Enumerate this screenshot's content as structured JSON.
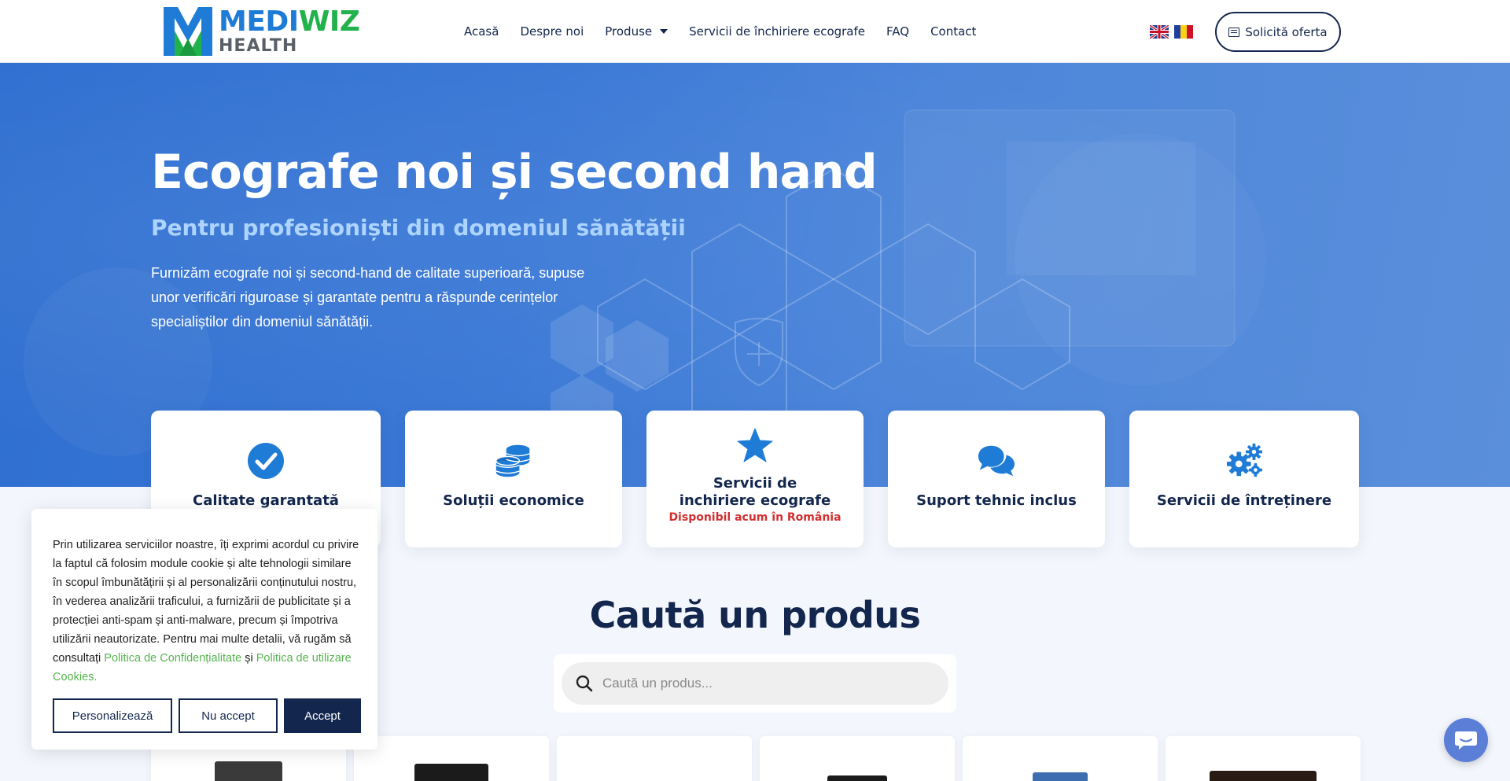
{
  "brand": {
    "name_part1": "MEDI",
    "name_part2": "WIZ",
    "subtitle": "HEALTH"
  },
  "nav": {
    "items": [
      {
        "label": "Acasă"
      },
      {
        "label": "Despre noi"
      },
      {
        "label": "Produse",
        "has_dropdown": true
      },
      {
        "label": "Servicii de închiriere ecografe"
      },
      {
        "label": "FAQ"
      },
      {
        "label": "Contact"
      }
    ],
    "languages": [
      "English",
      "Română"
    ],
    "cta_label": "Solicită oferta"
  },
  "hero": {
    "title": "Ecografe noi și second hand",
    "subtitle": "Pentru profesioniști din domeniul sănătății",
    "description": "Furnizăm ecografe noi și second-hand de calitate superioară, supuse unor verificări riguroase și garantate pentru a răspunde cerințelor specialiștilor din domeniul sănătății."
  },
  "features": [
    {
      "title": "Calitate garantată",
      "icon": "check-circle-icon"
    },
    {
      "title": "Soluții economice",
      "icon": "coins-icon"
    },
    {
      "title": "Servicii de inchiriere ecografe",
      "note": "Disponibil acum în România",
      "icon": "star-icon"
    },
    {
      "title": "Suport tehnic inclus",
      "icon": "chat-bubbles-icon"
    },
    {
      "title": "Servicii de întreținere",
      "icon": "gears-icon"
    }
  ],
  "search": {
    "title": "Caută un produs",
    "placeholder": "Caută un produs..."
  },
  "cookie": {
    "text_main": "Prin utilizarea serviciilor noastre, îți exprimi acordul cu privire la faptul că folosim module cookie și alte tehnologii similare în scopul îmbunătățirii și al personalizării conținutului nostru, în vederea analizării traficului, a furnizării de publicitate și a protecției anti-spam și anti-malware, precum și împotriva utilizării neautorizate.",
    "text_more": "Pentru mai multe detalii, vă rugăm să consultați",
    "link_privacy": "Politica de Confidențialitate",
    "and": "și",
    "link_cookies": "Politica de utilizare Cookies.",
    "btn_customize": "Personalizează",
    "btn_decline": "Nu accept",
    "btn_accept": "Accept"
  },
  "colors": {
    "navy": "#13264d",
    "brand_blue": "#1f7cd6",
    "brand_green": "#22b24c",
    "hero_blue": "#3a78d6",
    "accent_light_blue": "#a9d1ff",
    "note_red": "#d22f2f",
    "link_green": "#55b44f",
    "chat_blue": "#5b7fd6"
  }
}
